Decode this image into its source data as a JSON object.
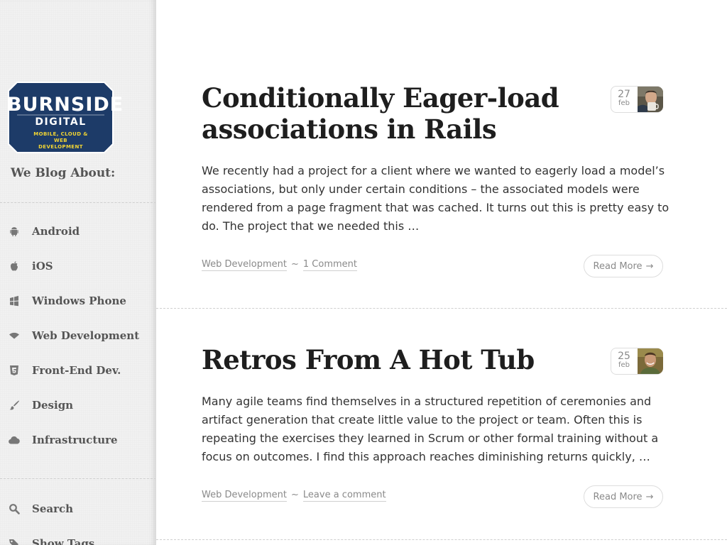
{
  "brand": {
    "name_line1": "BURNSIDE",
    "name_line2": "DIGITAL",
    "tagline": "MOBILE, CLOUD & WEB DEVELOPMENT",
    "colors": {
      "badge_fill": "#1d3b68",
      "badge_border": "#ffffff",
      "tagline": "#f2d533"
    }
  },
  "sidebar": {
    "heading": "We Blog About:",
    "categories": [
      {
        "label": "Android",
        "icon": "android-icon"
      },
      {
        "label": "iOS",
        "icon": "apple-icon"
      },
      {
        "label": "Windows Phone",
        "icon": "windows-icon"
      },
      {
        "label": "Web Development",
        "icon": "wifi-icon"
      },
      {
        "label": "Front-End Dev.",
        "icon": "html5-icon"
      },
      {
        "label": "Design",
        "icon": "brush-icon"
      },
      {
        "label": "Infrastructure",
        "icon": "cloud-icon"
      }
    ],
    "utility": [
      {
        "label": "Search",
        "icon": "search-icon"
      },
      {
        "label": "Show Tags",
        "icon": "tags-icon"
      }
    ]
  },
  "posts": [
    {
      "title": "Conditionally Eager-load associations in Rails",
      "excerpt": "We recently had a project for a client where we wanted to eagerly load a model’s associations, but only under certain conditions – the associated models were rendered from a page fragment that was cached. It turns out this is pretty easy to do. The project that we needed this …",
      "category": "Web Development",
      "separator": "~",
      "comments": "1 Comment",
      "date_day": "27",
      "date_month": "feb",
      "read_more": "Read More",
      "arrow": "→"
    },
    {
      "title": "Retros From A Hot Tub",
      "excerpt": "Many agile teams find themselves in a structured repetition of ceremonies and artifact generation that create little value to the project or team. Often this is repeating the exercises they learned in Scrum or other formal training without a focus on outcomes. I find this approach reaches diminishing returns quickly, …",
      "category": "Web Development",
      "separator": "~",
      "comments": "Leave a comment",
      "date_day": "25",
      "date_month": "feb",
      "read_more": "Read More",
      "arrow": "→"
    }
  ]
}
